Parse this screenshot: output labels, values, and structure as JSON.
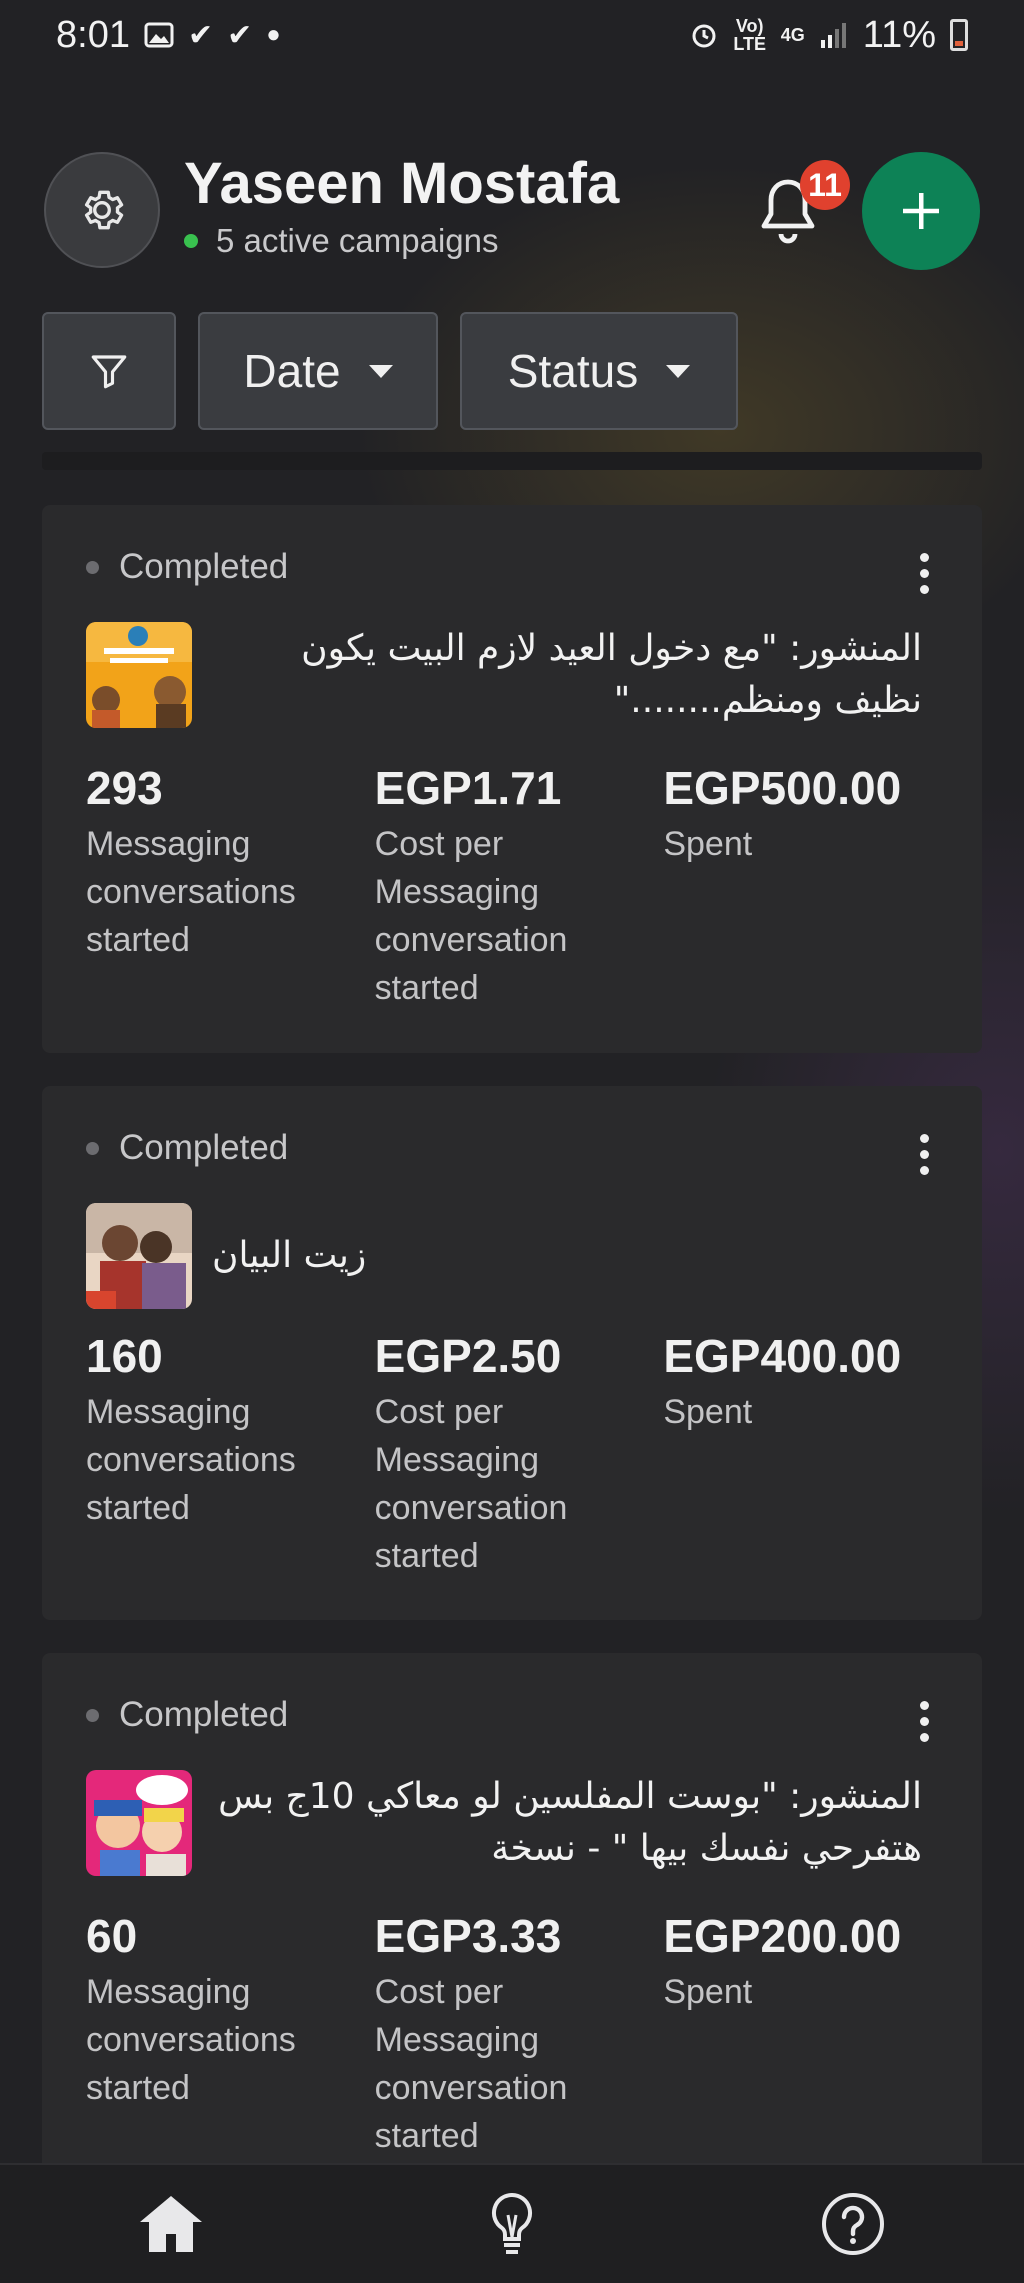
{
  "status_bar": {
    "time": "8:01",
    "network_volte": "Vo) LTE",
    "network_4g": "4G",
    "battery": "11%"
  },
  "header": {
    "user_name": "Yaseen Mostafa",
    "active_campaigns": "5 active campaigns",
    "notification_count": "11"
  },
  "filters": {
    "date_label": "Date",
    "status_label": "Status"
  },
  "campaigns": [
    {
      "status": "Completed",
      "title": "المنشور: \"مع دخول العيد لازم البيت يكون نظيف ومنظم........\"",
      "metrics": [
        {
          "value": "293",
          "label": "Messaging conversations started"
        },
        {
          "value": "EGP1.71",
          "label": "Cost per Messaging conversation started"
        },
        {
          "value": "EGP500.00",
          "label": "Spent"
        }
      ]
    },
    {
      "status": "Completed",
      "title": "زيت البيان",
      "metrics": [
        {
          "value": "160",
          "label": "Messaging conversations started"
        },
        {
          "value": "EGP2.50",
          "label": "Cost per Messaging conversation started"
        },
        {
          "value": "EGP400.00",
          "label": "Spent"
        }
      ]
    },
    {
      "status": "Completed",
      "title": "المنشور: \"بوست المفلسين  لو معاكي 10ج بس هتفرحي نفسك بيها \" - نسخة",
      "metrics": [
        {
          "value": "60",
          "label": "Messaging conversations started"
        },
        {
          "value": "EGP3.33",
          "label": "Cost per Messaging conversation started"
        },
        {
          "value": "EGP200.00",
          "label": "Spent"
        }
      ]
    }
  ],
  "bottom_nav": {
    "items": [
      "home-icon",
      "lightbulb-icon",
      "help-icon"
    ]
  },
  "colors": {
    "accent_green": "#0d8256",
    "badge_red": "#e0412e",
    "active_dot": "#39c14f",
    "card_bg": "#2a2a2c"
  }
}
